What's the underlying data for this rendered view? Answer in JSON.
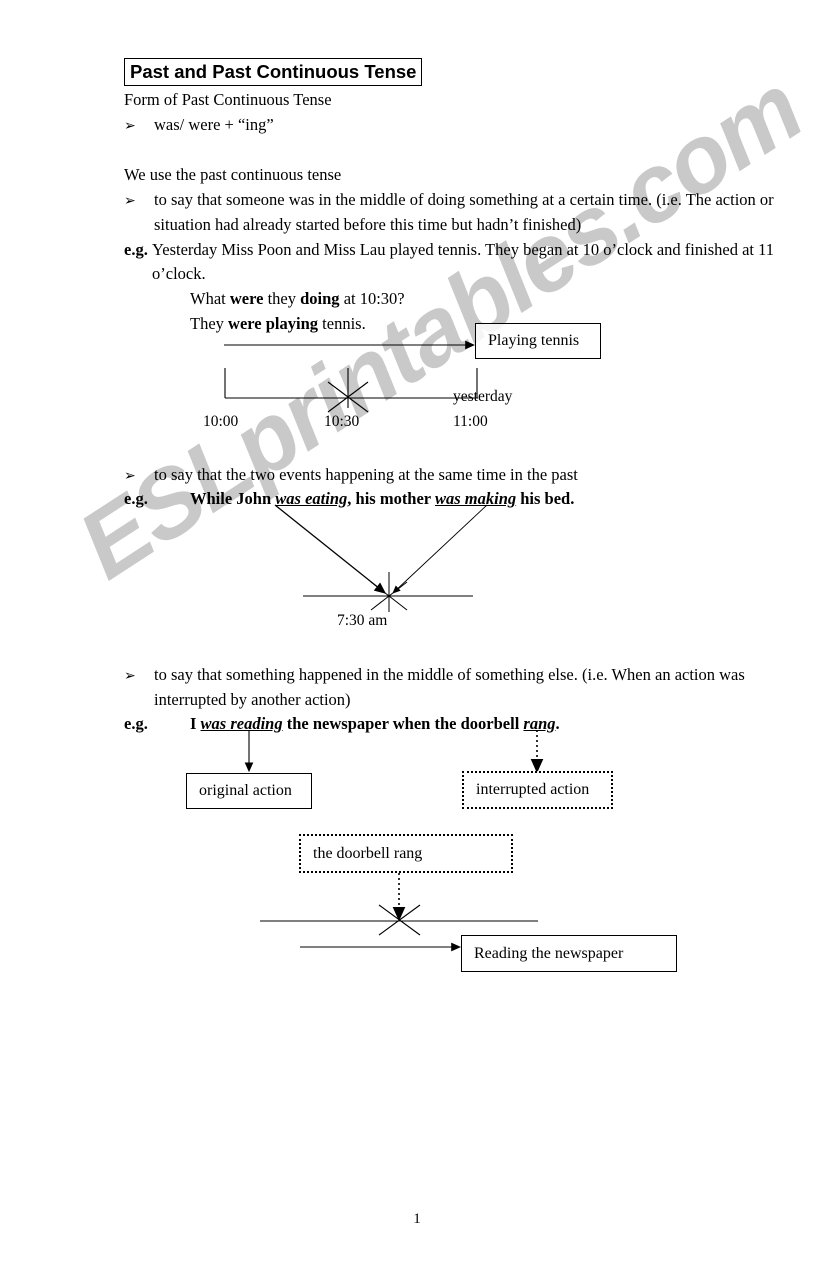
{
  "document": {
    "title": "Past and Past Continuous Tense",
    "page_number": "1",
    "watermark": "ESLprintables.com",
    "watermark_color": "#c9c9c9"
  },
  "form_section": {
    "heading": "Form of Past Continuous Tense",
    "bullet_glyph": "➢",
    "rule": "was/ were + “ing”"
  },
  "usage_intro": "We use the past continuous tense",
  "usage": [
    {
      "bullet_glyph": "➢",
      "text": "to say that someone was in the middle of doing something at a certain time.    (i.e. The action or situation had already started before this time but hadn’t finished)",
      "eg_label": "e.g.",
      "eg_text": "Yesterday Miss Poon and Miss Lau played tennis.    They began at 10 o’clock and finished at 11 o’clock."
    },
    {
      "bullet_glyph": "➢",
      "text": "to say that the two events happening at the same time in the past",
      "eg_label": "e.g."
    },
    {
      "bullet_glyph": "➢",
      "text": "to say that something happened in the middle of something else.    (i.e. When an action was interrupted by another action)",
      "eg_label": "e.g."
    }
  ],
  "example_one": {
    "question_parts": [
      "What ",
      "were",
      " they ",
      "doing",
      " at 10:30?"
    ],
    "answer_parts": [
      "They ",
      "were playing",
      " tennis."
    ],
    "box_label": "Playing tennis",
    "timeline": {
      "start_label": "10:00",
      "middle_label": "10:30",
      "end_label": "11:00",
      "day_label": "yesterday"
    }
  },
  "example_two": {
    "sentence_parts": [
      "While John ",
      "was eating",
      ", his mother ",
      "was making",
      " his bed."
    ],
    "time_label": "7:30 am"
  },
  "example_three": {
    "sentence_parts": [
      "I ",
      "was reading",
      " the newspaper when the doorbell ",
      "rang",
      "."
    ],
    "original_action_box": "original action",
    "interrupted_action_box": "interrupted action",
    "doorbell_box": "the doorbell rang",
    "reading_box": "Reading the newspaper"
  }
}
